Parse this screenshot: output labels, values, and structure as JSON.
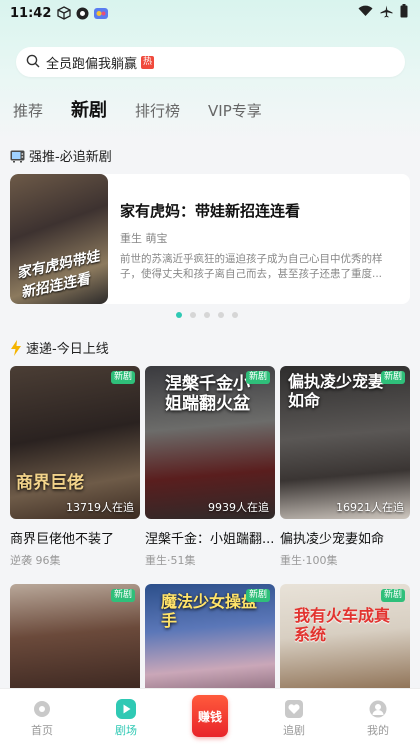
{
  "status_bar": {
    "time": "11:42"
  },
  "search": {
    "text": "全员跑偏我躺赢",
    "hot_badge": "热"
  },
  "tabs": [
    {
      "label": "推荐",
      "active": false
    },
    {
      "label": "新剧",
      "active": true
    },
    {
      "label": "排行榜",
      "active": false
    },
    {
      "label": "VIP专享",
      "active": false
    }
  ],
  "featured_section": {
    "title": "强推-必追新剧",
    "card": {
      "poster_text": "家有虎妈带娃新招连连看",
      "title": "家有虎妈：带娃新招连连看",
      "tags": "重生 萌宝",
      "description": "前世的苏漓近乎疯狂的逼迫孩子成为自己心目中优秀的样子，使得丈夫和孩子离自己而去，甚至孩子还患了重度..."
    },
    "carousel_count": 5,
    "carousel_active": 0
  },
  "today_section": {
    "title": "速递-今日上线",
    "items": [
      {
        "poster_text": "商界巨佬",
        "title": "商界巨佬他不装了",
        "meta": "逆袭 96集",
        "badge": "新剧",
        "watchers": "13719人在追"
      },
      {
        "poster_text": "涅槃千金小姐踹翻火盆",
        "title": "涅槃千金：小姐踹翻...",
        "meta": "重生·51集",
        "badge": "新剧",
        "watchers": "9939人在追"
      },
      {
        "poster_text": "偏执凌少宠妻如命",
        "title": "偏执凌少宠妻如命",
        "meta": "重生·100集",
        "badge": "新剧",
        "watchers": "16921人在追"
      },
      {
        "poster_text": "",
        "badge": "新剧"
      },
      {
        "poster_text": "魔法少女操盘手",
        "badge": "新剧"
      },
      {
        "poster_text": "我有火车成真系统",
        "badge": "新剧"
      }
    ]
  },
  "bottom_nav": [
    {
      "label": "首页",
      "active": false
    },
    {
      "label": "剧场",
      "active": true
    },
    {
      "label": "赚钱",
      "active": false
    },
    {
      "label": "追剧",
      "active": false
    },
    {
      "label": "我的",
      "active": false
    }
  ],
  "colors": {
    "accent": "#2fc9b4",
    "hot_red": "#f04a3c",
    "new_badge": "#2fbf7a",
    "earn_red": "#e8242a"
  }
}
